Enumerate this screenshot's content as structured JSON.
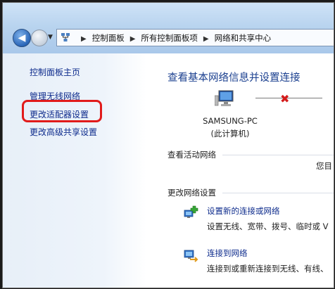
{
  "breadcrumb": [
    "控制面板",
    "所有控制面板项",
    "网络和共享中心"
  ],
  "sidebar": {
    "items": [
      {
        "label": "控制面板主页"
      },
      {
        "label": "管理无线网络"
      },
      {
        "label": "更改适配器设置"
      },
      {
        "label": "更改高级共享设置"
      }
    ],
    "highlight_color": "#e11b1b"
  },
  "main": {
    "title": "查看基本网络信息并设置连接",
    "computer_name": "SAMSUNG-PC",
    "computer_sub": "(此计算机)",
    "right_partial": "I",
    "active_networks_label": "查看活动网络",
    "active_partial": "您目",
    "change_settings_label": "更改网络设置",
    "tasks": [
      {
        "link": "设置新的连接或网络",
        "desc": "设置无线、宽带、拨号、临时或 V"
      },
      {
        "link": "连接到网络",
        "desc": "连接到或重新连接到无线、有线、"
      }
    ]
  }
}
